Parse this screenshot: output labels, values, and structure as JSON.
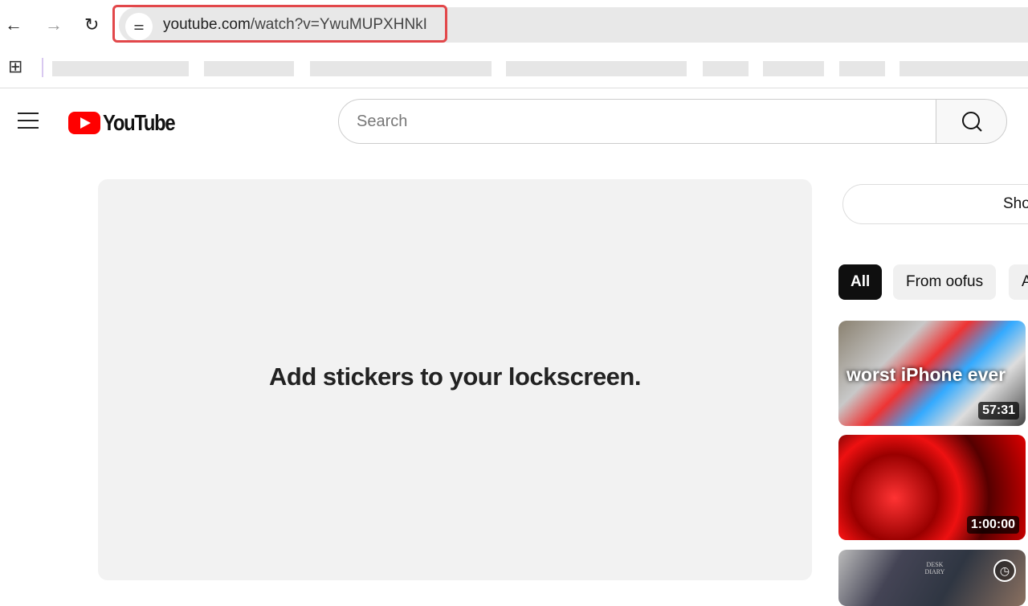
{
  "browser": {
    "url_domain": "youtube.com",
    "url_path": "/watch?v=YwuMUPXHNkI",
    "back_icon": "arrow-left-icon",
    "forward_icon": "arrow-right-icon",
    "reload_icon": "reload-icon",
    "site_info_icon": "tune-icon",
    "apps_icon": "apps-grid-icon"
  },
  "youtube": {
    "logo_text": "YouTube",
    "search_placeholder": "Search",
    "brand_color": "#ff0000"
  },
  "player": {
    "message": "Add stickers to your lockscreen."
  },
  "sidebar": {
    "top_button": "Sho",
    "chips": [
      {
        "label": "All",
        "active": true
      },
      {
        "label": "From oofus",
        "active": false
      },
      {
        "label": "A",
        "active": false
      }
    ],
    "videos": [
      {
        "overlay_text": "worst iPhone ever",
        "duration": "57:31"
      },
      {
        "duration": "1:00:00"
      },
      {
        "overlay_text": "DESK DIARY"
      }
    ]
  }
}
